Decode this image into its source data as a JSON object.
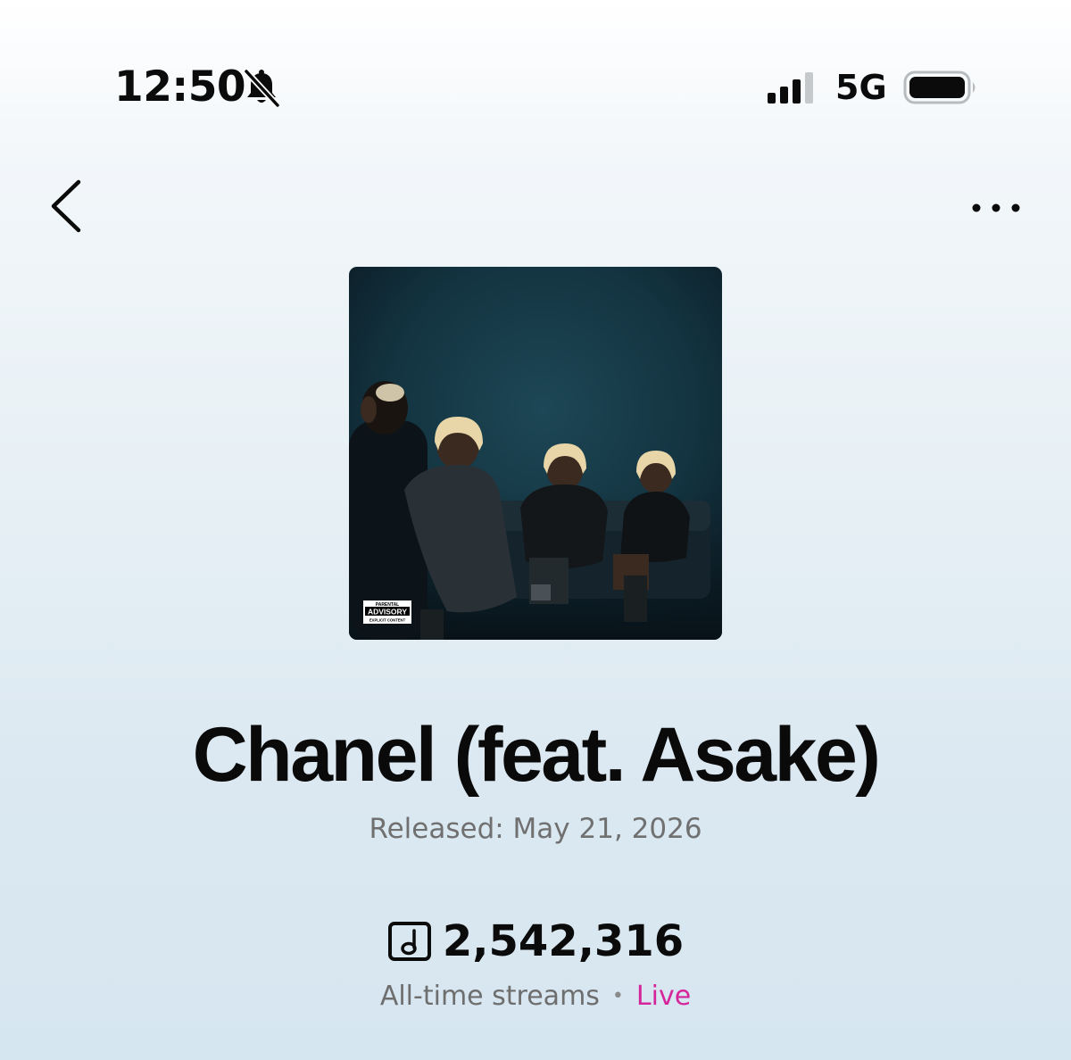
{
  "status_bar": {
    "time": "12:50",
    "network": "5G",
    "icons": [
      "bell-muted-icon",
      "signal-icon",
      "battery-icon"
    ]
  },
  "nav": {
    "back_icon": "chevron-left-icon",
    "more_icon": "more-dots-icon"
  },
  "track": {
    "title": "Chanel (feat. Asake)",
    "released": "Released: May 21, 2026",
    "streams": "2,542,316",
    "streams_label": "All-time streams",
    "separator": "•",
    "live_label": "Live",
    "artwork_badge": {
      "line1": "PARENTAL",
      "line2": "ADVISORY",
      "line3": "EXPLICIT CONTENT"
    }
  },
  "colors": {
    "live": "#d6249b",
    "muted_text": "#707070",
    "artwork_bg": "#14333f"
  }
}
